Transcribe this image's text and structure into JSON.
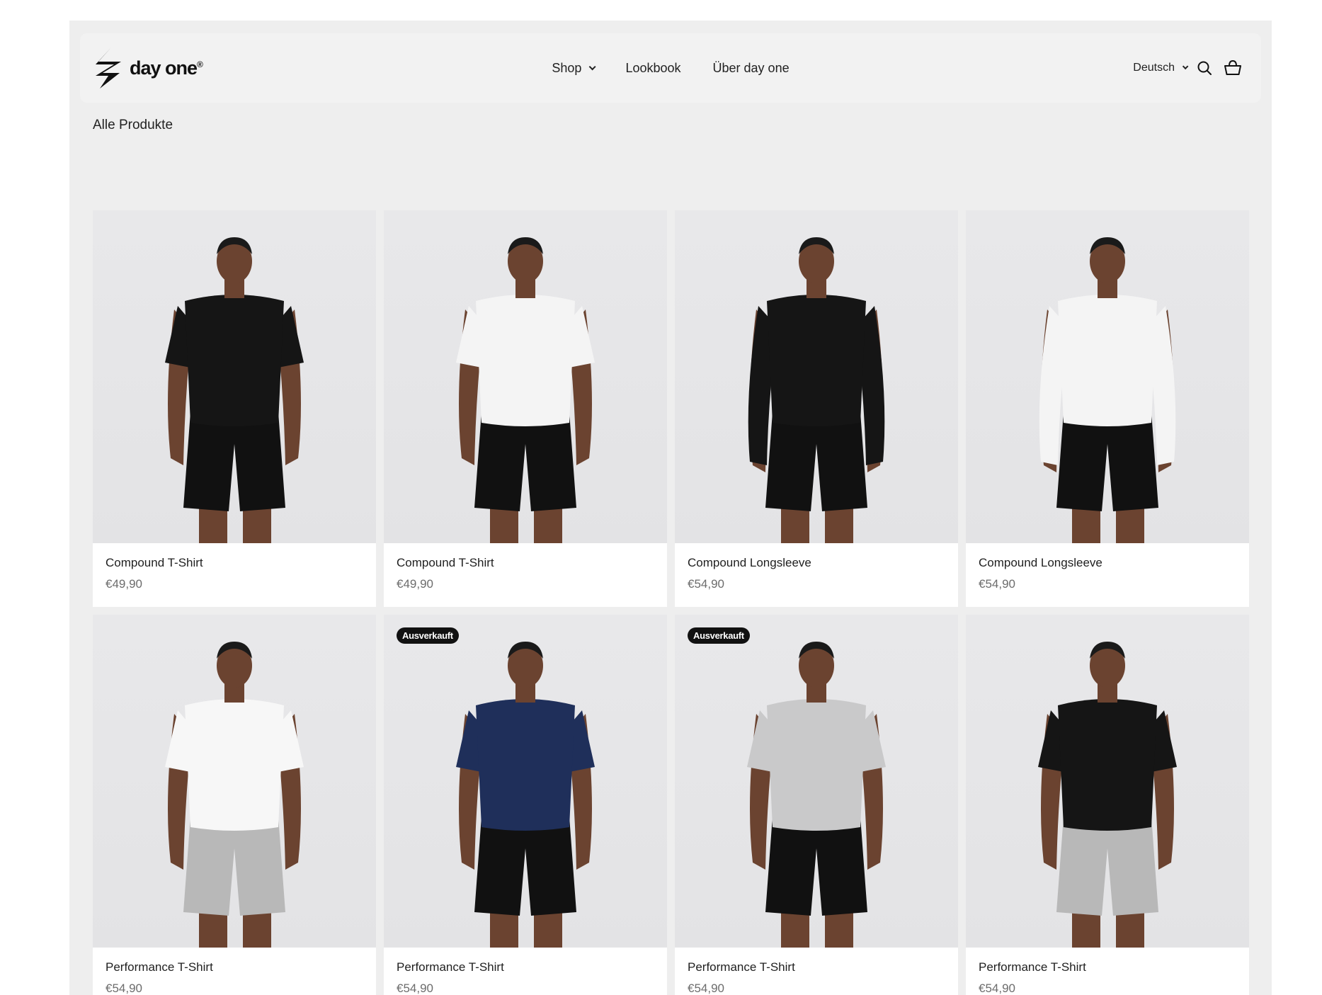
{
  "brand": {
    "name": "day one",
    "mark": "®"
  },
  "nav": {
    "shop": "Shop",
    "lookbook": "Lookbook",
    "about": "Über day one"
  },
  "utils": {
    "language": "Deutsch",
    "search_icon": "search-icon",
    "cart_icon": "basket-icon"
  },
  "breadcrumb": "Alle Produkte",
  "products": [
    {
      "title": "Compound T-Shirt",
      "price": "€49,90",
      "badge": "",
      "shirt": "#151515",
      "shorts": "#111111",
      "sleeves": "short"
    },
    {
      "title": "Compound T-Shirt",
      "price": "€49,90",
      "badge": "",
      "shirt": "#f4f4f4",
      "shorts": "#111111",
      "sleeves": "short"
    },
    {
      "title": "Compound Longsleeve",
      "price": "€54,90",
      "badge": "",
      "shirt": "#151515",
      "shorts": "#111111",
      "sleeves": "long"
    },
    {
      "title": "Compound Longsleeve",
      "price": "€54,90",
      "badge": "",
      "shirt": "#f4f4f4",
      "shorts": "#111111",
      "sleeves": "long"
    },
    {
      "title": "Performance T-Shirt",
      "price": "€54,90",
      "badge": "",
      "shirt": "#f7f7f7",
      "shorts": "#b8b8b8",
      "sleeves": "short"
    },
    {
      "title": "Performance T-Shirt",
      "price": "€54,90",
      "badge": "Ausverkauft",
      "shirt": "#1f2f5a",
      "shorts": "#111111",
      "sleeves": "short"
    },
    {
      "title": "Performance T-Shirt",
      "price": "€54,90",
      "badge": "Ausverkauft",
      "shirt": "#c9c9ca",
      "shorts": "#111111",
      "sleeves": "short"
    },
    {
      "title": "Performance T-Shirt",
      "price": "€54,90",
      "badge": "",
      "shirt": "#151515",
      "shorts": "#b8b8b8",
      "sleeves": "short"
    }
  ],
  "colors": {
    "page_bg": "#eeeeee",
    "header_bg": "#f2f2f2",
    "badge_bg": "#111111",
    "skin": "#6b4330",
    "price": "#6c6c6c"
  }
}
